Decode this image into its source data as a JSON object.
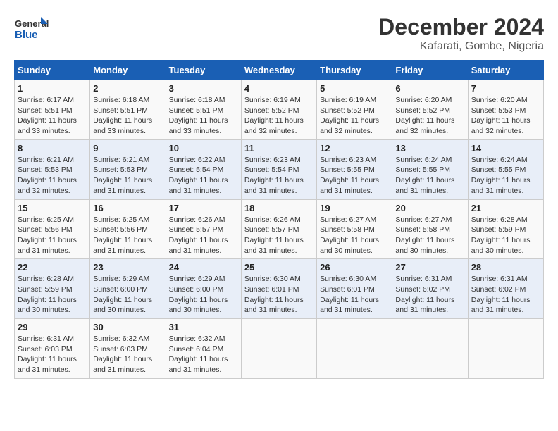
{
  "logo": {
    "text_general": "General",
    "text_blue": "Blue"
  },
  "title": "December 2024",
  "subtitle": "Kafarati, Gombe, Nigeria",
  "headers": [
    "Sunday",
    "Monday",
    "Tuesday",
    "Wednesday",
    "Thursday",
    "Friday",
    "Saturday"
  ],
  "weeks": [
    [
      {
        "day": "1",
        "sunrise": "6:17 AM",
        "sunset": "5:51 PM",
        "daylight": "11 hours and 33 minutes."
      },
      {
        "day": "2",
        "sunrise": "6:18 AM",
        "sunset": "5:51 PM",
        "daylight": "11 hours and 33 minutes."
      },
      {
        "day": "3",
        "sunrise": "6:18 AM",
        "sunset": "5:51 PM",
        "daylight": "11 hours and 33 minutes."
      },
      {
        "day": "4",
        "sunrise": "6:19 AM",
        "sunset": "5:52 PM",
        "daylight": "11 hours and 32 minutes."
      },
      {
        "day": "5",
        "sunrise": "6:19 AM",
        "sunset": "5:52 PM",
        "daylight": "11 hours and 32 minutes."
      },
      {
        "day": "6",
        "sunrise": "6:20 AM",
        "sunset": "5:52 PM",
        "daylight": "11 hours and 32 minutes."
      },
      {
        "day": "7",
        "sunrise": "6:20 AM",
        "sunset": "5:53 PM",
        "daylight": "11 hours and 32 minutes."
      }
    ],
    [
      {
        "day": "8",
        "sunrise": "6:21 AM",
        "sunset": "5:53 PM",
        "daylight": "11 hours and 32 minutes."
      },
      {
        "day": "9",
        "sunrise": "6:21 AM",
        "sunset": "5:53 PM",
        "daylight": "11 hours and 31 minutes."
      },
      {
        "day": "10",
        "sunrise": "6:22 AM",
        "sunset": "5:54 PM",
        "daylight": "11 hours and 31 minutes."
      },
      {
        "day": "11",
        "sunrise": "6:23 AM",
        "sunset": "5:54 PM",
        "daylight": "11 hours and 31 minutes."
      },
      {
        "day": "12",
        "sunrise": "6:23 AM",
        "sunset": "5:55 PM",
        "daylight": "11 hours and 31 minutes."
      },
      {
        "day": "13",
        "sunrise": "6:24 AM",
        "sunset": "5:55 PM",
        "daylight": "11 hours and 31 minutes."
      },
      {
        "day": "14",
        "sunrise": "6:24 AM",
        "sunset": "5:55 PM",
        "daylight": "11 hours and 31 minutes."
      }
    ],
    [
      {
        "day": "15",
        "sunrise": "6:25 AM",
        "sunset": "5:56 PM",
        "daylight": "11 hours and 31 minutes."
      },
      {
        "day": "16",
        "sunrise": "6:25 AM",
        "sunset": "5:56 PM",
        "daylight": "11 hours and 31 minutes."
      },
      {
        "day": "17",
        "sunrise": "6:26 AM",
        "sunset": "5:57 PM",
        "daylight": "11 hours and 31 minutes."
      },
      {
        "day": "18",
        "sunrise": "6:26 AM",
        "sunset": "5:57 PM",
        "daylight": "11 hours and 31 minutes."
      },
      {
        "day": "19",
        "sunrise": "6:27 AM",
        "sunset": "5:58 PM",
        "daylight": "11 hours and 30 minutes."
      },
      {
        "day": "20",
        "sunrise": "6:27 AM",
        "sunset": "5:58 PM",
        "daylight": "11 hours and 30 minutes."
      },
      {
        "day": "21",
        "sunrise": "6:28 AM",
        "sunset": "5:59 PM",
        "daylight": "11 hours and 30 minutes."
      }
    ],
    [
      {
        "day": "22",
        "sunrise": "6:28 AM",
        "sunset": "5:59 PM",
        "daylight": "11 hours and 30 minutes."
      },
      {
        "day": "23",
        "sunrise": "6:29 AM",
        "sunset": "6:00 PM",
        "daylight": "11 hours and 30 minutes."
      },
      {
        "day": "24",
        "sunrise": "6:29 AM",
        "sunset": "6:00 PM",
        "daylight": "11 hours and 30 minutes."
      },
      {
        "day": "25",
        "sunrise": "6:30 AM",
        "sunset": "6:01 PM",
        "daylight": "11 hours and 31 minutes."
      },
      {
        "day": "26",
        "sunrise": "6:30 AM",
        "sunset": "6:01 PM",
        "daylight": "11 hours and 31 minutes."
      },
      {
        "day": "27",
        "sunrise": "6:31 AM",
        "sunset": "6:02 PM",
        "daylight": "11 hours and 31 minutes."
      },
      {
        "day": "28",
        "sunrise": "6:31 AM",
        "sunset": "6:02 PM",
        "daylight": "11 hours and 31 minutes."
      }
    ],
    [
      {
        "day": "29",
        "sunrise": "6:31 AM",
        "sunset": "6:03 PM",
        "daylight": "11 hours and 31 minutes."
      },
      {
        "day": "30",
        "sunrise": "6:32 AM",
        "sunset": "6:03 PM",
        "daylight": "11 hours and 31 minutes."
      },
      {
        "day": "31",
        "sunrise": "6:32 AM",
        "sunset": "6:04 PM",
        "daylight": "11 hours and 31 minutes."
      },
      null,
      null,
      null,
      null
    ]
  ],
  "labels": {
    "sunrise": "Sunrise:",
    "sunset": "Sunset:",
    "daylight": "Daylight:"
  }
}
